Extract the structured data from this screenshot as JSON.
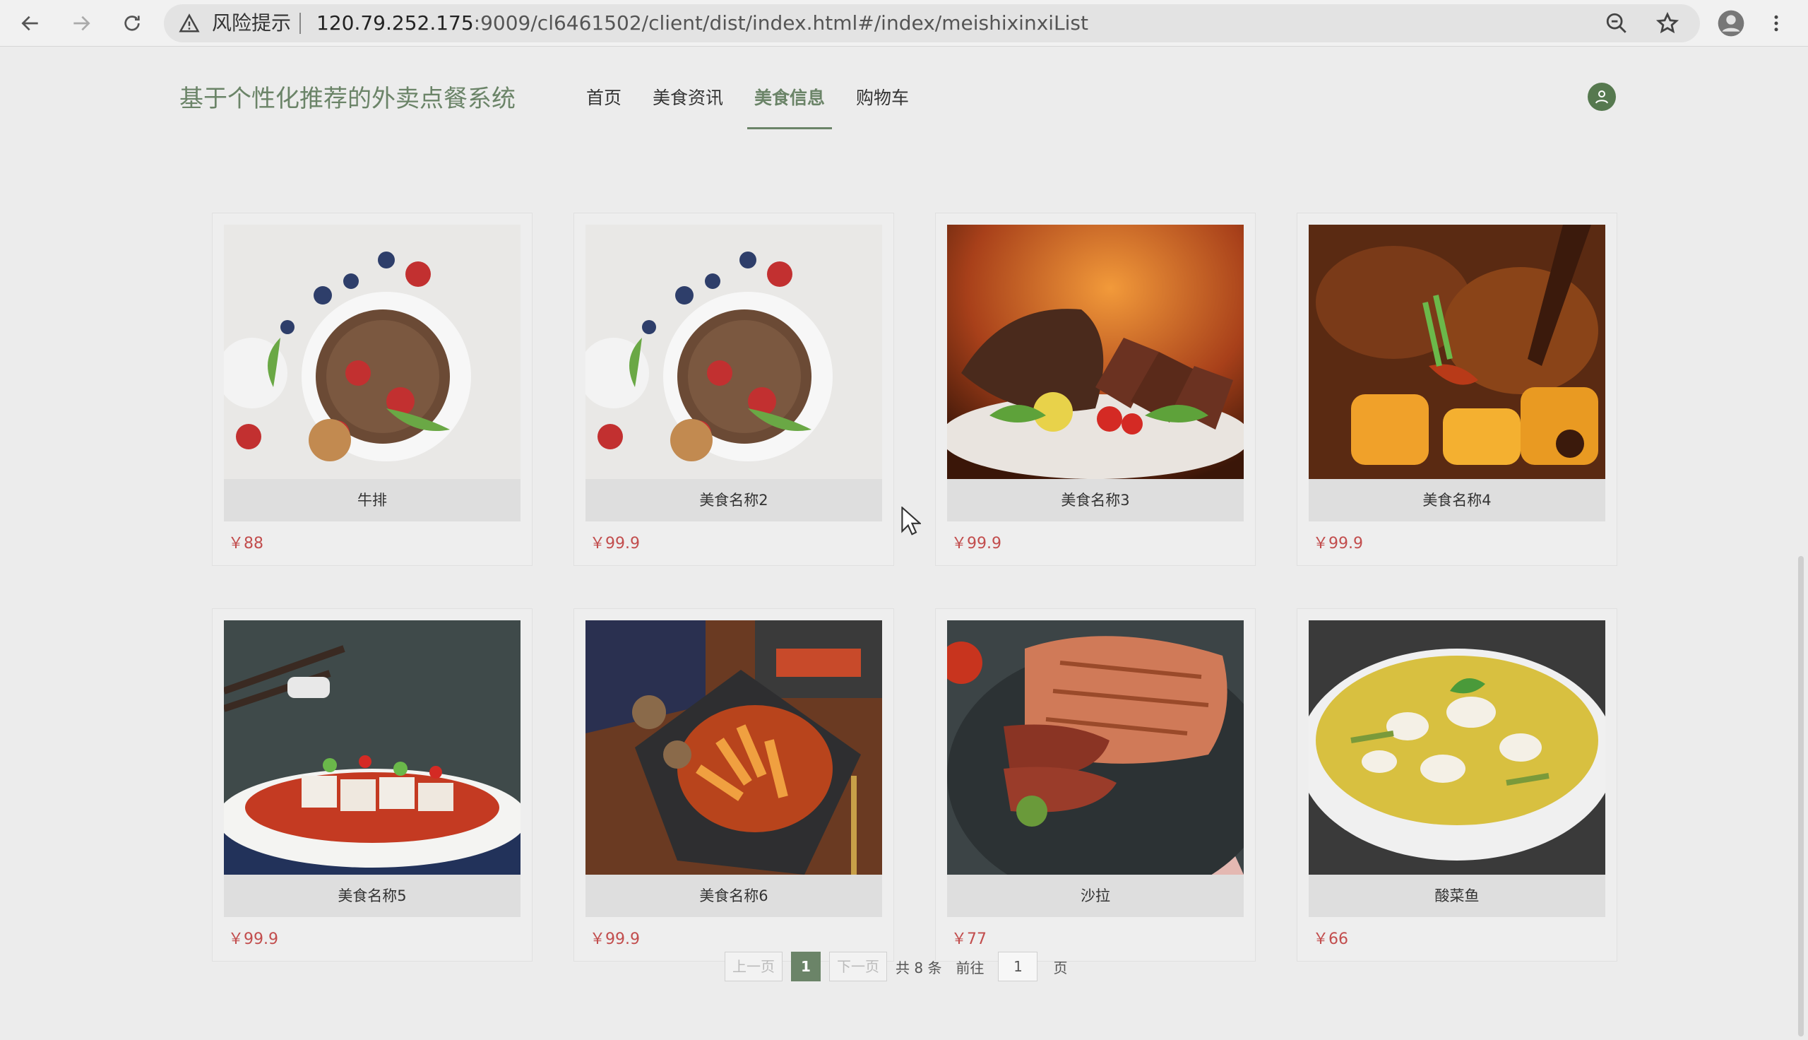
{
  "browser": {
    "risk_label": "风险提示",
    "url_host": "120.79.252.175",
    "url_rest": ":9009/cl6461502/client/dist/index.html#/index/meishixinxiList"
  },
  "header": {
    "brand": "基于个性化推荐的外卖点餐系统",
    "menu": [
      {
        "label": "首页"
      },
      {
        "label": "美食资讯"
      },
      {
        "label": "美食信息"
      },
      {
        "label": "购物车"
      }
    ]
  },
  "foods": [
    {
      "name": "牛排",
      "price": "￥88",
      "image": "dessert-bowl"
    },
    {
      "name": "美食名称2",
      "price": "￥99.9",
      "image": "dessert-bowl"
    },
    {
      "name": "美食名称3",
      "price": "￥99.9",
      "image": "grilled-steak"
    },
    {
      "name": "美食名称4",
      "price": "￥99.9",
      "image": "braised-chicken"
    },
    {
      "name": "美食名称5",
      "price": "￥99.9",
      "image": "jelly-plate"
    },
    {
      "name": "美食名称6",
      "price": "￥99.9",
      "image": "spicy-dish"
    },
    {
      "name": "沙拉",
      "price": "￥77",
      "image": "sliced-steak"
    },
    {
      "name": "酸菜鱼",
      "price": "￥66",
      "image": "fish-soup"
    }
  ],
  "pagination": {
    "prev": "上一页",
    "current": "1",
    "next": "下一页",
    "total": "共 8 条",
    "goto": "前往",
    "page_input": "1",
    "page_suffix": "页"
  },
  "colors": {
    "accent": "#6b8468",
    "price": "#c24d4d"
  }
}
